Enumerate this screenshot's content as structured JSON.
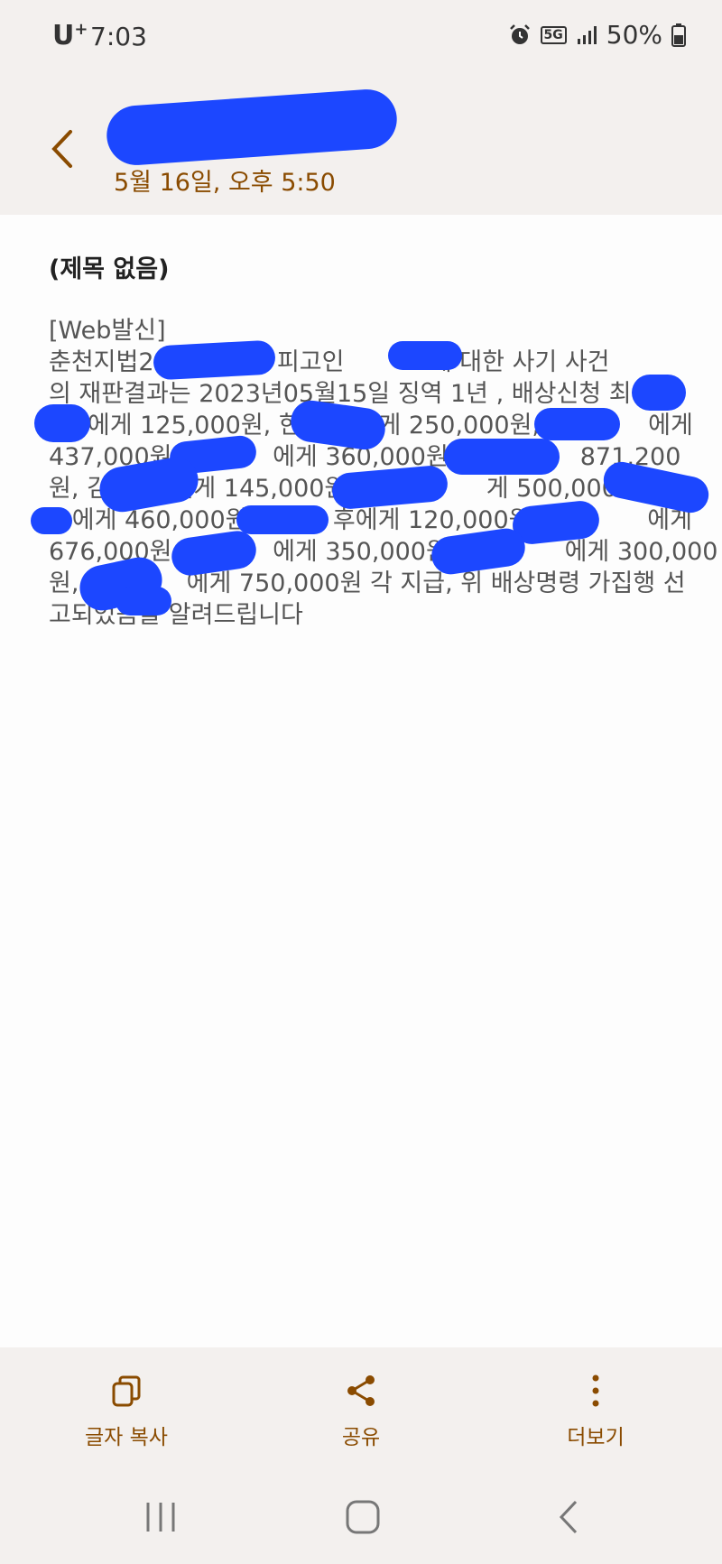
{
  "status": {
    "carrier": "U",
    "carrier_sup": "+",
    "time": "7:03",
    "network": "5G",
    "battery": "50%"
  },
  "header": {
    "date": "5월 16일, 오후 5:50"
  },
  "message": {
    "subject": "(제목 없음)",
    "body_lines": [
      "[Web발신]",
      "춘천지법2            호 피고인           에 대한 사기 사건",
      "의 재판결과는 2023년05월15일 징역 1년 , 배상신청 최",
      "     에게 125,000원, 한          게 250,000원,              에게",
      "437,000원,            에게 360,000원, 0             871,200",
      "원, 김        에게 145,000원, 0              게 500,000원, 고",
      "   에게 460,000원           후에게 120,000원,              에게",
      "676,000원,            에게 350,000원, 3           에게 300,000",
      "원, 최          에게 750,000원 각 지급, 위 배상명령 가집행 선",
      "고되었음을 알려드립니다"
    ]
  },
  "toolbar": {
    "copy_label": "글자 복사",
    "share_label": "공유",
    "more_label": "더보기"
  },
  "colors": {
    "accent": "#8a4b00",
    "redaction": "#1c47ff",
    "header_bg": "#f3f0ee"
  }
}
